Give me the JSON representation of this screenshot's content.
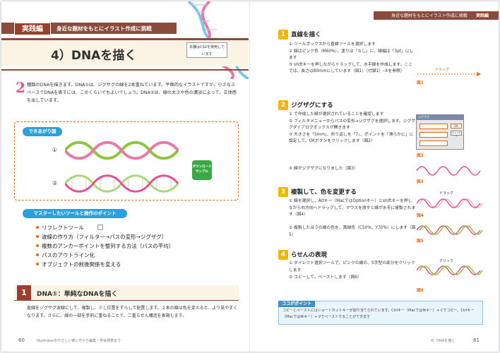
{
  "left_page": {
    "header_badge": "実践編",
    "header_subtitle": "身近な題材をもとにイラスト作成に挑戦",
    "title": "4）DNAを描く",
    "sticker": "本課はCS2を使用しています",
    "intro_number": "2",
    "intro_text": "種類のDNAを描きます。DNA①は、ジグザグの線を2本重ねています。平面的なイラストですが、小さなスペースでDNAを表すには、このくらいでもよいでしょう。DNA②は、線の太さや色の濃淡によって、立体感を出しています。",
    "completed_label": "できあがり図",
    "example_num_1": "①",
    "example_num_2": "②",
    "badge_label": "ダウンロードサンプル",
    "tools_label": "マスターしたいツールと操作のポイント",
    "tools": [
      "リフレクトツール",
      "波線の作り方（フィルター→パスの変形→ジグザグ）",
      "複数のアンカーポイントを整列する方法（パスの平均）",
      "パスのアウトライン化",
      "オブジェクトの前後関係を変える"
    ],
    "section_number": "1",
    "section_title": "DNA①：単純なDNAを描く",
    "section_text": "直線をジグザグ波線にして、複製し、少し位置をずらして配置します。２本の線は色を変えると、より見やすくなります。さらに、線の一部を手前に重ねることで、二重らせん構造を表現します。",
    "page_number": "60",
    "footer_text": "Illustratorのやさしい使い方から編集・学会発表まで"
  },
  "right_page": {
    "header_subtitle": "身近な題材をもとにイラスト作成に挑戦",
    "header_badge": "実践編",
    "steps": [
      {
        "num": "1",
        "title": "直線を描く",
        "items": [
          {
            "n": "①",
            "text": "ツールボックスから直線ツールを選択します"
          },
          {
            "n": "②",
            "text": "線はピンク色（M60%）、塗りは「なし」に、線幅は「3pt」にします"
          },
          {
            "n": "③",
            "text": "shiftキーを押しながらドラッグして、水平線を作成します。ここでは、長さは80mmにしています（図1）（付録1）-③を参照）"
          }
        ]
      },
      {
        "num": "2",
        "title": "ジグザグにする",
        "items": [
          {
            "n": "①",
            "text": "で作成した線が選択されていることを確認します"
          },
          {
            "n": "②",
            "text": "フィルタメニューからパスの変形→ジグザグを選択します。ジグザグダイアログボックスが開きます"
          },
          {
            "n": "③",
            "text": "大きさを「5mm」、折り返しを「7」、ポイントを「滑らかに」に設定して、OKボタンをクリックします（図2）"
          },
          {
            "n": "④",
            "text": "線がジグザグになりました（図3）"
          }
        ]
      },
      {
        "num": "3",
        "title": "複製して、色を変更する",
        "items": [
          {
            "n": "①",
            "text": "線を選択し、Altキー（MacではOptionキー）とshiftキーを押しながら右方向へドラッグして、マウスを放すと線が水平に複製されます（図4）"
          },
          {
            "n": "②",
            "text": "複製したほうの線の色を、黄緑色（C50%、Y70%）にします（図5）"
          }
        ]
      },
      {
        "num": "4",
        "title": "らせんの表現",
        "items": [
          {
            "n": "①",
            "text": "ダイレクト選択ツールで、ピンクの線の、S字型の部分をクリックします"
          },
          {
            "n": "②",
            "text": "コピーして、ペーストします（図6）"
          }
        ]
      }
    ],
    "drag_label_1": "ドラッグ",
    "drag_label_2": "ドラッグ",
    "click_label": "クリック",
    "figure_labels": [
      "図1",
      "図2",
      "図3",
      "図4",
      "図5",
      "図6"
    ],
    "dialog_title": "ジグザグ",
    "dialog_ok": "OK",
    "dialog_cancel": "キャンセル",
    "point_title": "ココがポイント",
    "point_text": "コピーとペーストにはショートカットキーが割り当てられています。Ctrlキー（Macでは⌘キー）+ Cでコピー、Ctrlキー（Macでは⌘キー）+ Vでペーストすることができます",
    "page_number": "61",
    "footer_text": "4）DNAを描く"
  },
  "colors": {
    "accent": "#9b3f2e",
    "header": "#8a4a3c",
    "step_badge": "#f2b500",
    "pink": "#e8508a",
    "green": "#8cc63f",
    "blue": "#2ba0dc",
    "figure_orange": "#e06a10"
  }
}
